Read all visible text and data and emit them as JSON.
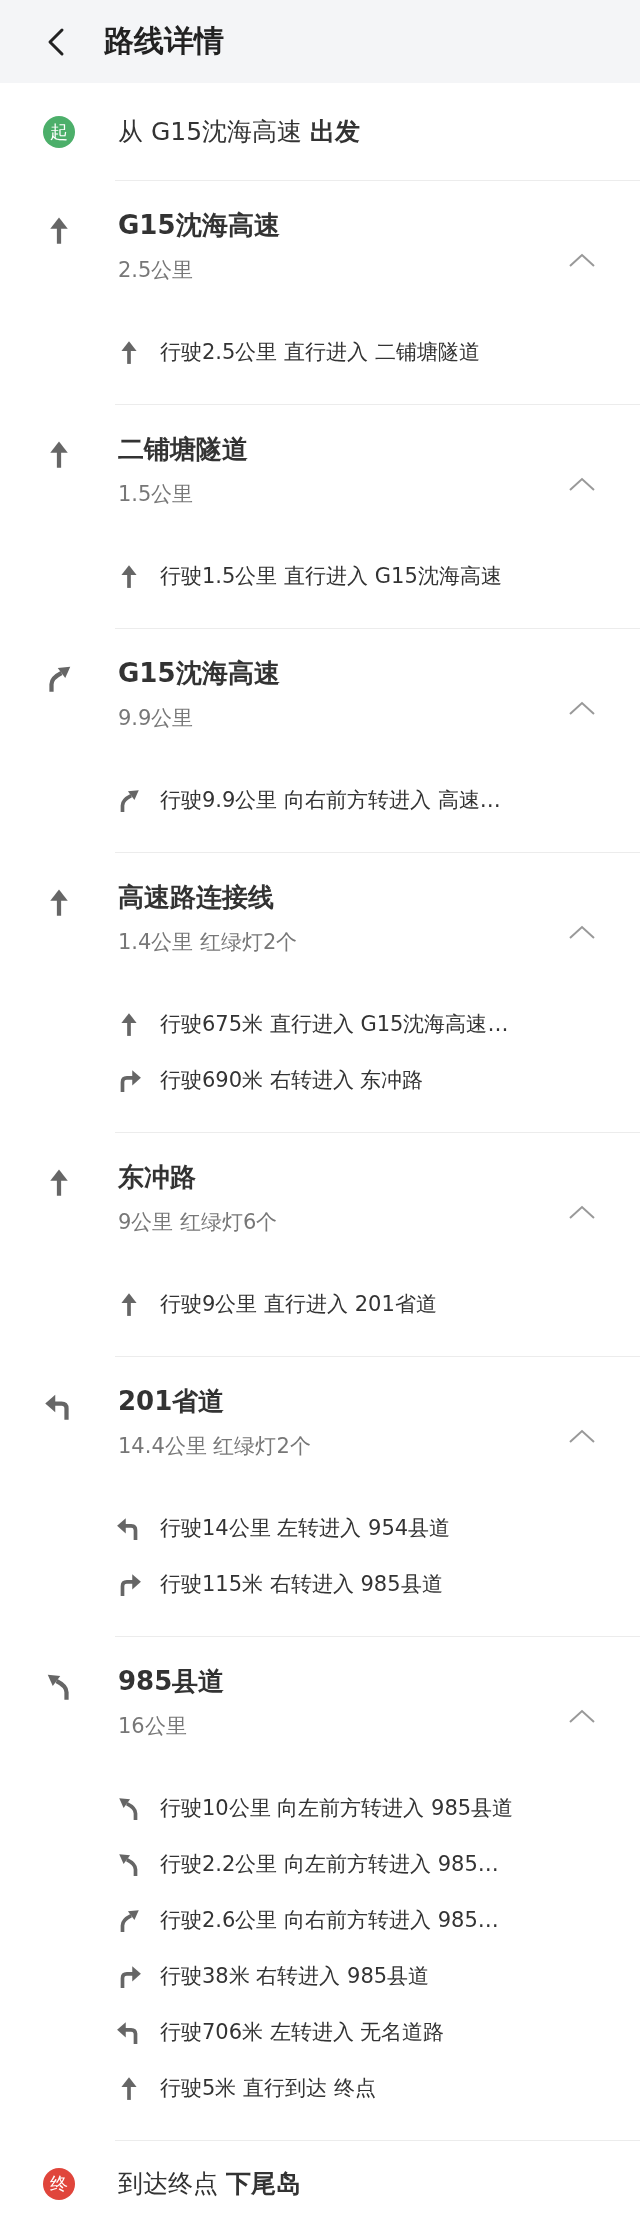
{
  "header": {
    "title": "路线详情"
  },
  "start": {
    "badge": "起",
    "text": "从 G15沈海高速 **出发**"
  },
  "sections": [
    {
      "kind": "straight",
      "name": "G15沈海高速",
      "details": "2.5公里",
      "expanded": true,
      "steps": [
        {
          "kind": "straight",
          "text": "行驶2.5公里 直行进入 二铺塘隧道"
        }
      ]
    },
    {
      "kind": "straight",
      "name": "二铺塘隧道",
      "details": "1.5公里",
      "expanded": true,
      "steps": [
        {
          "kind": "straight",
          "text": "行驶1.5公里 直行进入 G15沈海高速"
        }
      ]
    },
    {
      "kind": "slight_right",
      "name": "G15沈海高速",
      "details": "9.9公里",
      "expanded": true,
      "steps": [
        {
          "kind": "slight_right",
          "text": "行驶9.9公里 向右前方转进入 高速…"
        }
      ]
    },
    {
      "kind": "straight",
      "name": "高速路连接线",
      "details": "1.4公里 红绿灯2个",
      "expanded": true,
      "steps": [
        {
          "kind": "straight",
          "text": "行驶675米 直行进入 G15沈海高速…"
        },
        {
          "kind": "right",
          "text": "行驶690米 右转进入 东冲路"
        }
      ]
    },
    {
      "kind": "straight",
      "name": "东冲路",
      "details": "9公里 红绿灯6个",
      "expanded": true,
      "steps": [
        {
          "kind": "straight",
          "text": "行驶9公里 直行进入 201省道"
        }
      ]
    },
    {
      "kind": "left",
      "name": "201省道",
      "details": "14.4公里 红绿灯2个",
      "expanded": true,
      "steps": [
        {
          "kind": "left",
          "text": "行驶14公里 左转进入 954县道"
        },
        {
          "kind": "right",
          "text": "行驶115米 右转进入 985县道"
        }
      ]
    },
    {
      "kind": "slight_left",
      "name": "985县道",
      "details": "16公里",
      "expanded": true,
      "steps": [
        {
          "kind": "slight_left",
          "text": "行驶10公里 向左前方转进入 985县道"
        },
        {
          "kind": "slight_left",
          "text": "行驶2.2公里 向左前方转进入 985…"
        },
        {
          "kind": "slight_right",
          "text": "行驶2.6公里 向右前方转进入 985…"
        },
        {
          "kind": "right",
          "text": "行驶38米 右转进入 985县道"
        },
        {
          "kind": "left",
          "text": "行驶706米 左转进入 无名道路"
        },
        {
          "kind": "straight",
          "text": "行驶5米 直行到达 终点"
        }
      ]
    }
  ],
  "end": {
    "badge": "终",
    "text": "到达终点 **下尾岛**"
  }
}
